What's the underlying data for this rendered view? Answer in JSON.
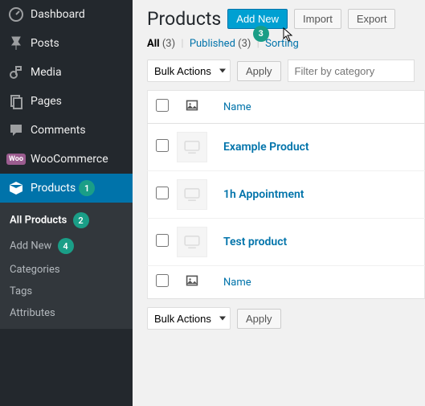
{
  "sidebar": {
    "items": [
      {
        "label": "Dashboard",
        "icon": "dashboard"
      },
      {
        "label": "Posts",
        "icon": "pin"
      },
      {
        "label": "Media",
        "icon": "media"
      },
      {
        "label": "Pages",
        "icon": "pages"
      },
      {
        "label": "Comments",
        "icon": "comments"
      },
      {
        "label": "WooCommerce",
        "icon": "woo"
      },
      {
        "label": "Products",
        "icon": "products",
        "badge": "1",
        "active": true
      }
    ],
    "submenu": [
      {
        "label": "All Products",
        "badge": "2",
        "current": true
      },
      {
        "label": "Add New",
        "badge": "4"
      },
      {
        "label": "Categories"
      },
      {
        "label": "Tags"
      },
      {
        "label": "Attributes"
      }
    ]
  },
  "header": {
    "title": "Products",
    "add_new": "Add New",
    "add_new_badge": "3",
    "import": "Import",
    "export": "Export"
  },
  "filters": {
    "all_label": "All",
    "all_count": "(3)",
    "published_label": "Published",
    "published_count": "(3)",
    "sorting": "Sorting"
  },
  "bulk": {
    "actions": "Bulk Actions",
    "apply": "Apply",
    "filter_placeholder": "Filter by category"
  },
  "table": {
    "col_name": "Name",
    "rows": [
      {
        "name": "Example Product"
      },
      {
        "name": "1h Appointment"
      },
      {
        "name": "Test product"
      }
    ]
  }
}
